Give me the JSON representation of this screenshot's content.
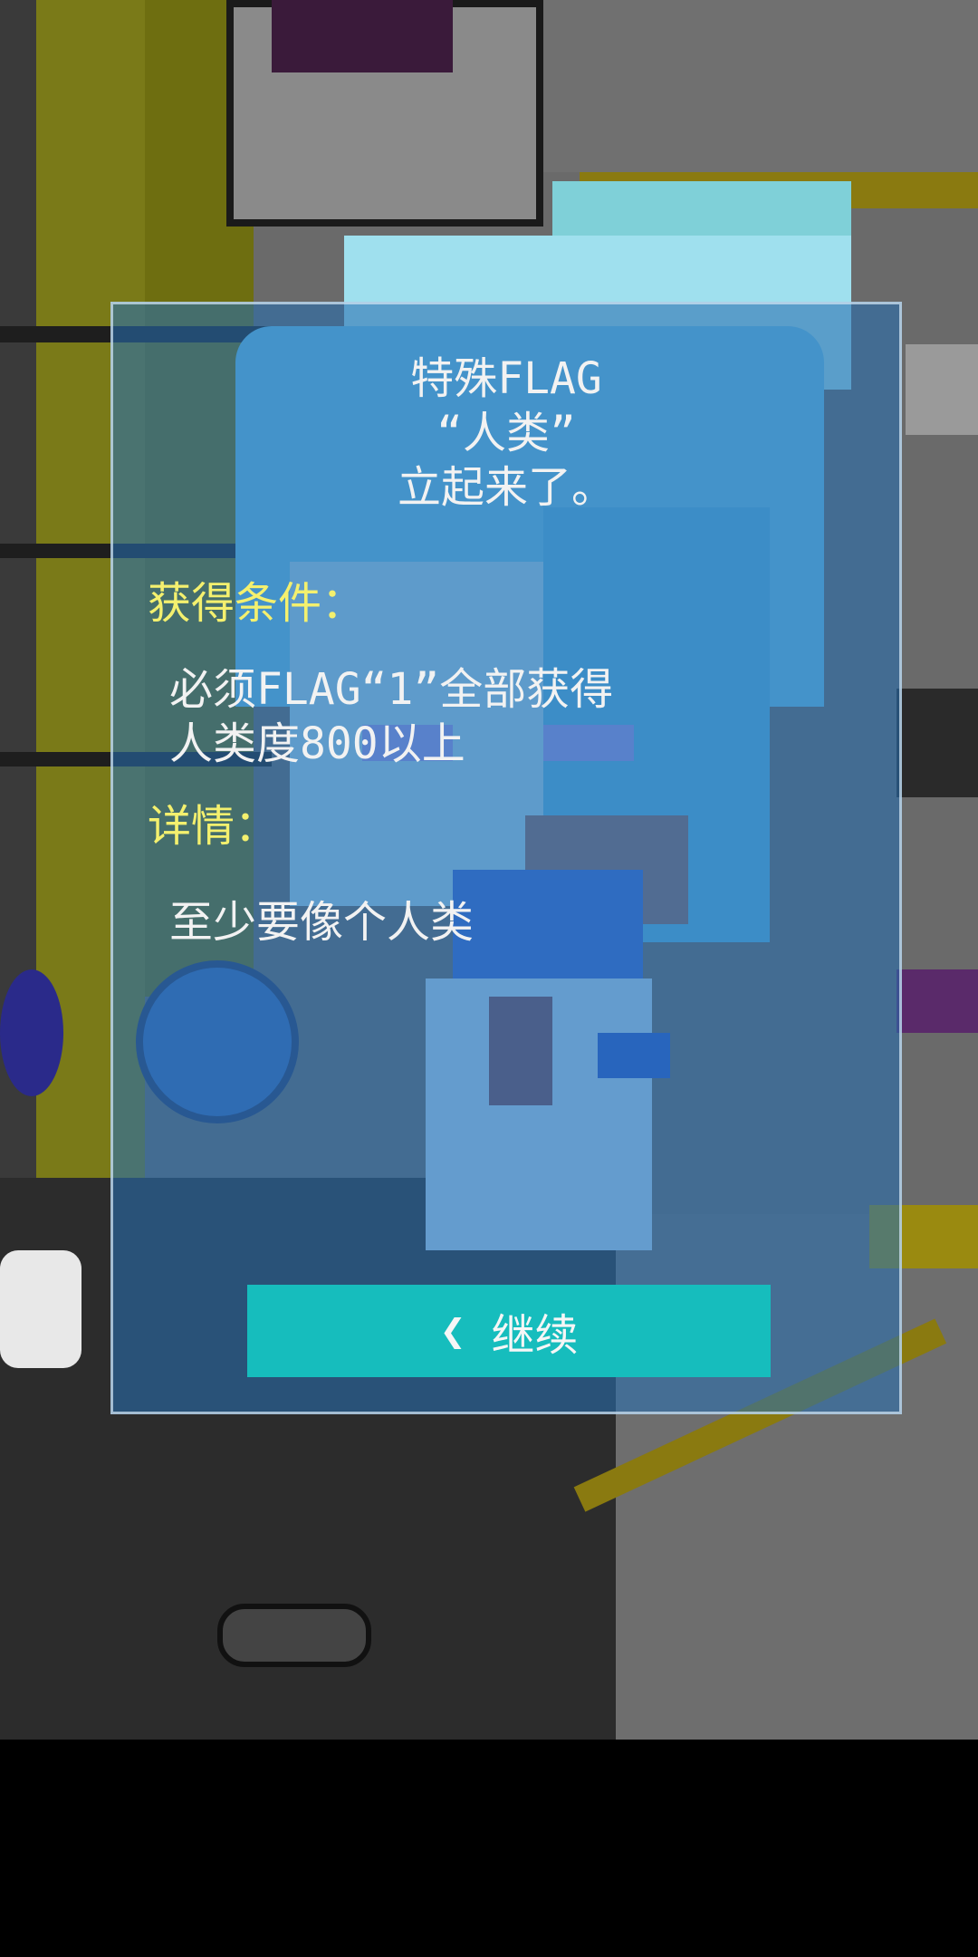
{
  "dialog": {
    "title_lines": [
      "特殊FLAG",
      "“人类”",
      "立起来了。"
    ],
    "condition_label": "获得条件：",
    "condition_lines": [
      "必须FLAG“1”全部获得",
      "人类度800以上"
    ],
    "detail_label": "详情：",
    "detail_text": "至少要像个人类",
    "continue_label": "继续",
    "continue_icon": "chevron-left-icon"
  },
  "colors": {
    "label_yellow": "#f4f06e",
    "button_teal": "#16bdbd",
    "panel_blue": "#286eaf"
  }
}
